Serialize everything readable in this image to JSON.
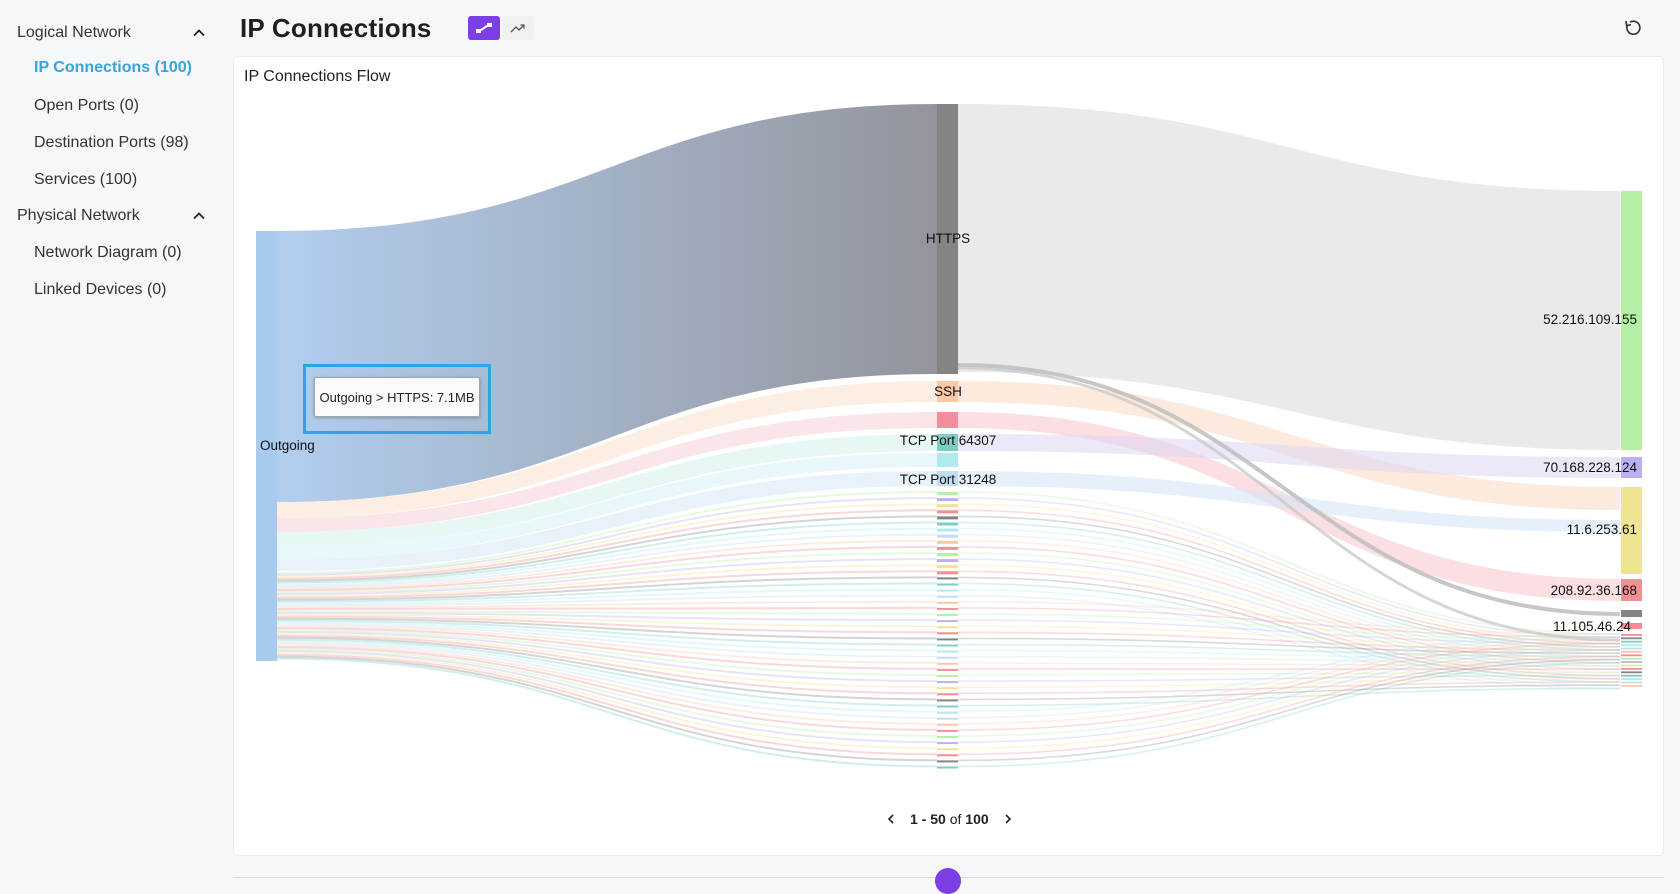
{
  "sidebar": {
    "logical_network": {
      "title": "Logical Network",
      "items": [
        {
          "label": "IP Connections (100)",
          "active": true
        },
        {
          "label": "Open Ports (0)"
        },
        {
          "label": "Destination Ports (98)"
        },
        {
          "label": "Services (100)"
        }
      ]
    },
    "physical_network": {
      "title": "Physical Network",
      "items": [
        {
          "label": "Network Diagram (0)"
        },
        {
          "label": "Linked Devices (0)"
        }
      ]
    }
  },
  "header": {
    "title": "IP Connections",
    "view_toggle": [
      "flow-view-icon",
      "trend-view-icon"
    ],
    "refresh_icon": "refresh-icon"
  },
  "panel": {
    "title": "IP Connections Flow"
  },
  "chart_data": {
    "type": "sankey",
    "title": "IP Connections Flow",
    "source_node": "Outgoing",
    "service_nodes": [
      "HTTPS",
      "SSH",
      "TCP Port 64307",
      "TCP Port 31248"
    ],
    "destination_nodes": [
      "52.216.109.155",
      "70.168.228.124",
      "11.6.253.61",
      "208.92.36.168",
      "11.105.46.24"
    ],
    "tooltip": "Outgoing > HTTPS: 7.1MB"
  },
  "pagination": {
    "start": "1",
    "end": "50",
    "of": "of",
    "total": "100"
  },
  "colors": {
    "accent": "#7b3fe4",
    "active_link": "#3aa3d9",
    "highlight_frame": "#2aa5e6",
    "source_node": "#a8caef",
    "https_node": "#858385",
    "dest_main": "#b5f0a5"
  }
}
